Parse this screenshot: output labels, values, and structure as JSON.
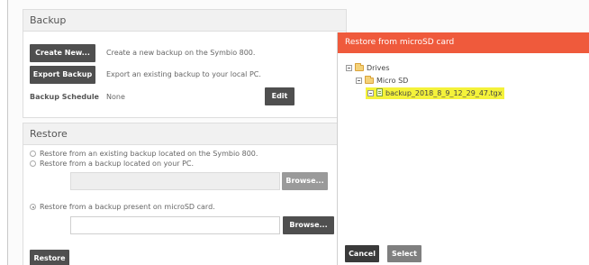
{
  "backup": {
    "title": "Backup",
    "create_label": "Create New...",
    "create_desc": "Create a new backup on the Symbio 800.",
    "export_label": "Export Backup",
    "export_desc": "Export an existing backup to your local PC.",
    "schedule_label": "Backup Schedule",
    "schedule_value": "None",
    "edit_label": "Edit"
  },
  "restore": {
    "title": "Restore",
    "options": [
      "Restore from an existing backup located on the Symbio 800.",
      "Restore from a backup located on your PC.",
      "Restore from a backup present on microSD card."
    ],
    "selected_option": 2,
    "browse_label": "Browse...",
    "restore_label": "Restore"
  },
  "modal": {
    "title": "Restore from microSD card",
    "tree": {
      "root": "Drives",
      "folder": "Micro SD",
      "file": "backup_2018_8_9_12_29_47.tgx"
    },
    "cancel_label": "Cancel",
    "select_label": "Select",
    "accent": "#ef5a3c",
    "highlight": "#f4f23a"
  }
}
